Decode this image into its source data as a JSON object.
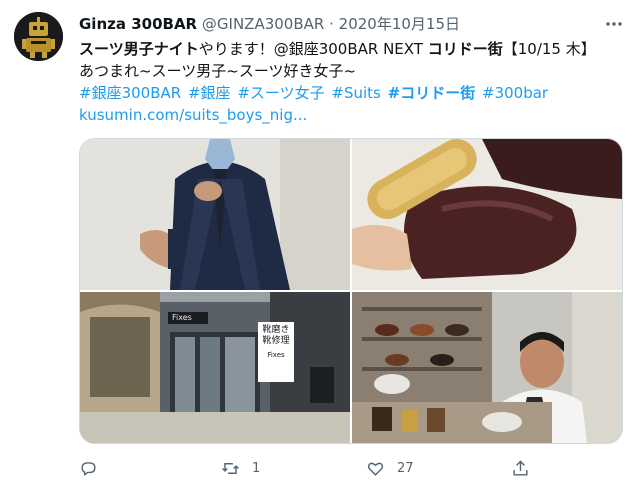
{
  "tweet": {
    "display_name": "Ginza 300BAR",
    "handle": "@GINZA300BAR",
    "separator": "·",
    "date": "2020年10月15日",
    "line1": {
      "bold_a": "スーツ男子ナイト",
      "normal_a": "やります！@銀座300BAR NEXT ",
      "bold_b": "コリドー街",
      "normal_b": "【10/15 木】"
    },
    "line2": "あつまれ~スーツ男子~スーツ好き女子~",
    "hashtags": [
      "#銀座300BAR",
      "#銀座",
      "#スーツ女子",
      "#Suits",
      "#コリドー街",
      "#300bar"
    ],
    "link": "kusumin.com/suits_boys_nig..."
  },
  "media": {
    "sign_text_1": "靴磨き",
    "sign_text_2": "靴修理",
    "sign_brand": "Fixes",
    "shop_brand": "Fixes"
  },
  "actions": {
    "reply_icon": "reply-icon",
    "retweet_icon": "retweet-icon",
    "retweet_count": "1",
    "like_icon": "heart-icon",
    "like_count": "27",
    "share_icon": "share-icon"
  },
  "colors": {
    "link": "#1d9bf0",
    "text": "#0f1419",
    "secondary": "#536471",
    "border": "#cfd9de"
  }
}
